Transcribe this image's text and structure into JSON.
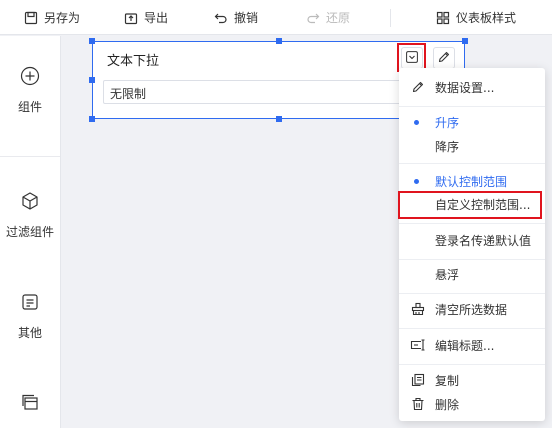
{
  "toolbar": {
    "save_as": "另存为",
    "export": "导出",
    "undo": "撤销",
    "redo": "还原",
    "dashboard_style": "仪表板样式"
  },
  "sidebar": {
    "items": [
      {
        "label": "组件",
        "icon": "plus-circle-icon"
      },
      {
        "label": "过滤组件",
        "icon": "cube-icon"
      },
      {
        "label": "其他",
        "icon": "doc-icon"
      },
      {
        "label": "",
        "icon": "layers-icon"
      }
    ]
  },
  "widget": {
    "title": "文本下拉",
    "select_value": "无限制"
  },
  "menu": {
    "data_settings": "数据设置...",
    "ascending": "升序",
    "descending": "降序",
    "default_range": "默认控制范围",
    "custom_range": "自定义控制范围...",
    "login_name_default": "登录名传递默认值",
    "float": "悬浮",
    "clear_data": "清空所选数据",
    "edit_title": "编辑标题...",
    "copy": "复制",
    "delete": "删除"
  },
  "colors": {
    "accent": "#2f6bf0",
    "highlight": "#e0141e"
  }
}
